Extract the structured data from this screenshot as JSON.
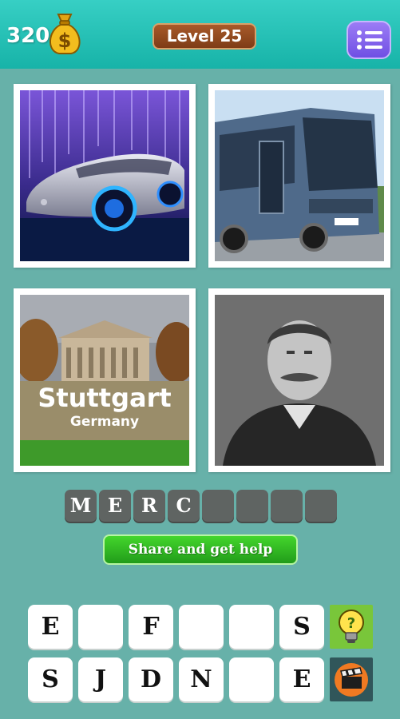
{
  "header": {
    "coins": "320",
    "level_label": "Level 25"
  },
  "pictures": [
    {
      "name": "concept-car"
    },
    {
      "name": "coach-bus"
    },
    {
      "name": "stuttgart-city",
      "caption": "Stuttgart",
      "subcaption": "Germany"
    },
    {
      "name": "portrait-man"
    }
  ],
  "answer": {
    "letters": [
      "M",
      "E",
      "R",
      "C",
      "",
      "",
      "",
      ""
    ]
  },
  "share_button": {
    "label": "Share and get help"
  },
  "keyboard": {
    "row1": [
      "E",
      "",
      "F",
      "",
      "",
      "S"
    ],
    "row2": [
      "S",
      "J",
      "D",
      "N",
      "",
      "E"
    ]
  },
  "colors": {
    "background": "#67b1a9",
    "topbar": "#22bdb1",
    "level_badge": "#8f4820",
    "menu_button": "#7c5ce9",
    "share_button": "#2fb51f",
    "slot": "#5f6462"
  },
  "icons": {
    "coins": "money-bag-icon",
    "menu": "list-menu-icon",
    "hint": "lightbulb-hint-icon",
    "video": "clapperboard-video-icon"
  }
}
